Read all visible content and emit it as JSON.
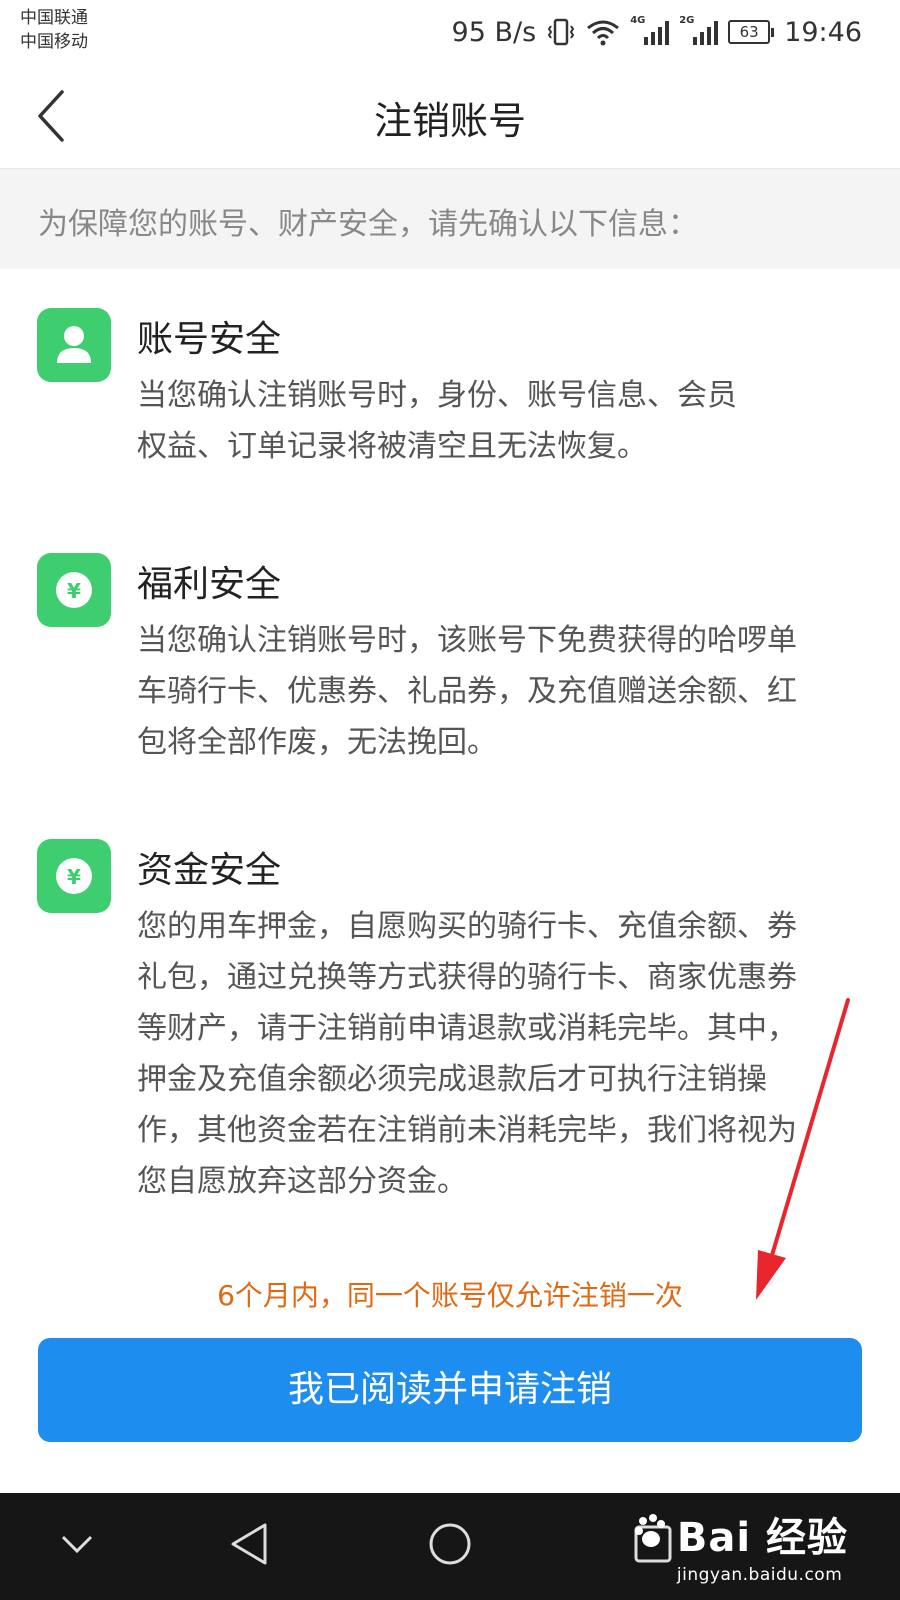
{
  "status_bar": {
    "carrier_1": "中国联通",
    "carrier_2": "中国移动",
    "net_speed": "95 B/s",
    "signal_1_label": "4G",
    "signal_2_label": "2G",
    "battery": "63",
    "time": "19:46"
  },
  "header": {
    "title": "注销账号",
    "back_icon": "chevron-left-icon"
  },
  "notice": "为保障您的账号、财产安全，请先确认以下信息：",
  "sections": [
    {
      "icon": "person-icon",
      "title": "账号安全",
      "text": "当您确认注销账号时，身份、账号信息、会员\n权益、订单记录将被清空且无法恢复。"
    },
    {
      "icon": "yuan-coin-icon",
      "title": "福利安全",
      "text": "当您确认注销账号时，该账号下免费获得的哈啰单\n车骑行卡、优惠券、礼品券，及充值赠送余额、红\n包将全部作废，无法挽回。"
    },
    {
      "icon": "yuan-coin-icon",
      "title": "资金安全",
      "text": "您的用车押金，自愿购买的骑行卡、充值余额、券\n礼包，通过兑换等方式获得的骑行卡、商家优惠券\n等财产，请于注销前申请退款或消耗完毕。其中，\n押金及充值余额必须完成退款后才可执行注销操\n作，其他资金若在注销前未消耗完毕，我们将视为\n您自愿放弃这部分资金。"
    }
  ],
  "warning": "6个月内，同一个账号仅允许注销一次",
  "primary_button": "我已阅读并申请注销",
  "colors": {
    "icon_green": "#3fce6f",
    "button_blue": "#1e8df0",
    "warning_orange": "#e06a14",
    "annotation_red": "#e8262b"
  },
  "watermark": {
    "brand": "Bai 经验",
    "url": "jingyan.baidu.com"
  }
}
